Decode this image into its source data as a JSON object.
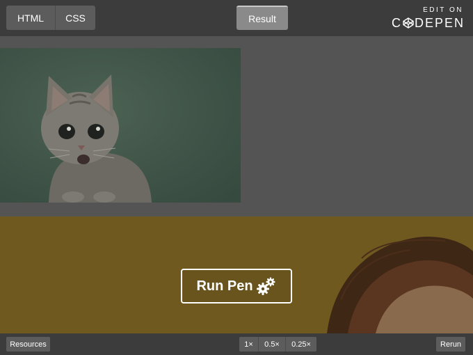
{
  "tabs": {
    "html": "HTML",
    "css": "CSS",
    "result": "Result"
  },
  "brand": {
    "edit_on": "EDIT ON",
    "codepen_prefix": "C",
    "codepen_suffix": "DEPEN"
  },
  "run_pen": {
    "label": "Run Pen",
    "icon": "gears-icon"
  },
  "bottom": {
    "resources": "Resources",
    "zoom_options": [
      "1×",
      "0.5×",
      "0.25×"
    ],
    "rerun": "Rerun"
  },
  "colors": {
    "bar_bg": "#3c3c3c",
    "tab_bg": "#5c5c5c",
    "tab_active_bg": "#8a8a8a",
    "cat_bg": "#3f5448",
    "portrait_bg": "#6f5a22"
  }
}
